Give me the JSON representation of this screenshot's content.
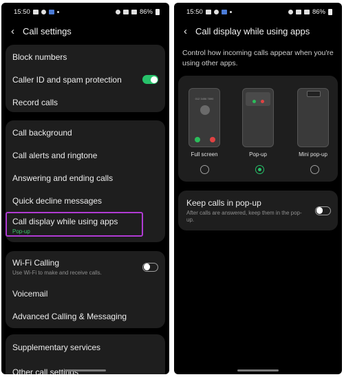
{
  "status": {
    "time": "15:50",
    "battery": "86%"
  },
  "left": {
    "title": "Call settings",
    "groups": [
      [
        {
          "label": "Block numbers"
        },
        {
          "label": "Caller ID and spam protection",
          "toggle": "on"
        },
        {
          "label": "Record calls"
        }
      ],
      [
        {
          "label": "Call background"
        },
        {
          "label": "Call alerts and ringtone"
        },
        {
          "label": "Answering and ending calls"
        },
        {
          "label": "Quick decline messages"
        },
        {
          "label": "Call display while using apps",
          "sub": "Pop-up"
        }
      ],
      [
        {
          "label": "Wi-Fi Calling",
          "sub": "Use Wi-Fi to make and receive calls.",
          "toggle": "off"
        },
        {
          "label": "Voicemail"
        },
        {
          "label": "Advanced Calling & Messaging"
        }
      ],
      [
        {
          "label": "Supplementary services"
        },
        {
          "label": "Other call settings"
        }
      ]
    ]
  },
  "right": {
    "title": "Call display while using apps",
    "description": "Control how incoming calls appear when you're using other apps.",
    "options": [
      {
        "label": "Full screen",
        "selected": false,
        "number": "012 3456 7890"
      },
      {
        "label": "Pop-up",
        "selected": true
      },
      {
        "label": "Mini pop-up",
        "selected": false
      }
    ],
    "keep_popup": {
      "label": "Keep calls in pop-up",
      "sub": "After calls are answered, keep them in the pop-up.",
      "toggle": "off"
    }
  },
  "colors": {
    "accent": "#27c26a",
    "highlight": "#b13bd4",
    "card": "#1e1e1e"
  }
}
